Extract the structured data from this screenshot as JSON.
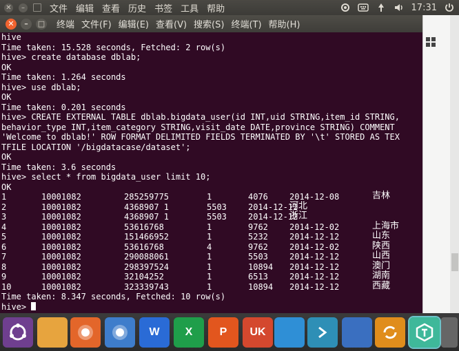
{
  "topbar": {
    "menus": [
      "文件",
      "编辑",
      "查看",
      "历史",
      "书签",
      "工具",
      "帮助"
    ],
    "indicators": [
      "system-settings-icon",
      "input-method-icon",
      "network-icon",
      "volume-icon"
    ],
    "time": "17:31"
  },
  "terminal": {
    "menus": [
      "终端",
      "文件(F)",
      "编辑(E)",
      "查看(V)",
      "搜索(S)",
      "终端(T)",
      "帮助(H)"
    ],
    "lines": [
      "hive",
      "Time taken: 15.528 seconds, Fetched: 2 row(s)",
      "hive> create database dblab;",
      "OK",
      "Time taken: 1.264 seconds",
      "hive> use dblab;",
      "OK",
      "Time taken: 0.201 seconds",
      "hive> CREATE EXTERNAL TABLE dblab.bigdata_user(id INT,uid STRING,item_id STRING,",
      "behavior_type INT,item_category STRING,visit_date DATE,province STRING) COMMENT",
      "'Welcome to dblab!' ROW FORMAT DELIMITED FIELDS TERMINATED BY '\\t' STORED AS TEX",
      "TFILE LOCATION '/bigdatacase/dataset';",
      "OK",
      "Time taken: 3.6 seconds",
      "hive> select * from bigdata_user limit 10;",
      "OK"
    ],
    "rows": [
      [
        "1",
        "10001082",
        "285259775",
        "1",
        "4076",
        "2014-12-08",
        "吉林"
      ],
      [
        "2",
        "10001082",
        "4368907 1",
        "5503",
        "2014-12-12",
        "河北",
        ""
      ],
      [
        "3",
        "10001082",
        "4368907 1",
        "5503",
        "2014-12-12",
        "浙江",
        ""
      ],
      [
        "4",
        "10001082",
        "53616768",
        "1",
        "9762",
        "2014-12-02",
        "上海市"
      ],
      [
        "5",
        "10001082",
        "151466952",
        "1",
        "5232",
        "2014-12-12",
        "山东"
      ],
      [
        "6",
        "10001082",
        "53616768",
        "4",
        "9762",
        "2014-12-02",
        "陕西"
      ],
      [
        "7",
        "10001082",
        "290088061",
        "1",
        "5503",
        "2014-12-12",
        "山西"
      ],
      [
        "8",
        "10001082",
        "298397524",
        "1",
        "10894",
        "2014-12-12",
        "澳门"
      ],
      [
        "9",
        "10001082",
        "32104252",
        "1",
        "6513",
        "2014-12-12",
        "湖南"
      ],
      [
        "10",
        "10001082",
        "323339743",
        "1",
        "10894",
        "2014-12-12",
        "西藏"
      ]
    ],
    "footer": "Time taken: 8.347 seconds, Fetched: 10 row(s)",
    "prompt": "hive> "
  },
  "bgwin": {
    "code": [
      "",
      "",
      "",
      "",
      "",
      "",
      "",
      "",
      "",
      "",
      "",
      ""
    ]
  },
  "dock": {
    "items": [
      {
        "name": "ubuntu-dash-icon",
        "label": "",
        "color": "#6f3f8f"
      },
      {
        "name": "files-icon",
        "label": "",
        "color": "#e7a43e"
      },
      {
        "name": "firefox-icon",
        "label": "",
        "color": "#e3662a"
      },
      {
        "name": "chromium-icon",
        "label": "",
        "color": "#3e7dcb"
      },
      {
        "name": "wps-writer-icon",
        "label": "W",
        "color": "#2a6bd6"
      },
      {
        "name": "wps-spreadsheet-icon",
        "label": "X",
        "color": "#1f9e4a"
      },
      {
        "name": "wps-presentation-icon",
        "label": "P",
        "color": "#e2561e"
      },
      {
        "name": "ubuntu-software-icon",
        "label": "UK",
        "color": "#d4482e"
      },
      {
        "name": "remmina-icon",
        "label": "",
        "color": "#2f8fd6"
      },
      {
        "name": "terminal-launcher-icon",
        "label": "",
        "color": "#2e8fb6"
      },
      {
        "name": "workspaces-icon",
        "label": "",
        "color": "#3a6fc0"
      },
      {
        "name": "software-updater-icon",
        "label": "",
        "color": "#e08d1c"
      },
      {
        "name": "alternate-app-icon",
        "label": "",
        "color": "#3fb89a"
      },
      {
        "name": "trash-icon",
        "label": "",
        "color": "#666666"
      }
    ]
  }
}
